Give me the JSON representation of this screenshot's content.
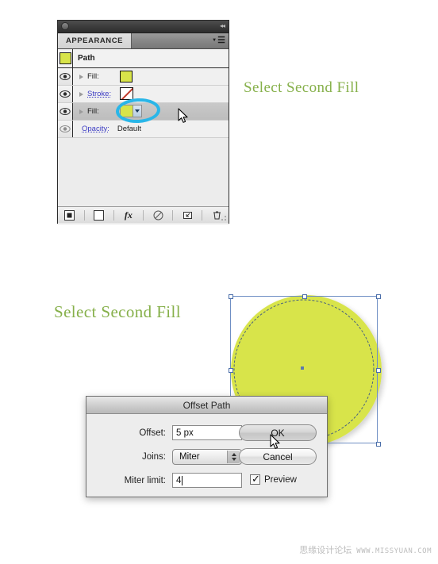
{
  "panel": {
    "tab_label": "APPEARANCE",
    "menu_icon": "panel-menu-icon",
    "collapse_icon": "collapse-arrows-icon",
    "header": {
      "label": "Path",
      "thumbnail_color": "#d8e44a"
    },
    "rows": [
      {
        "label": "Fill:",
        "type": "fill",
        "swatch_color": "#d8e44a",
        "visible": true
      },
      {
        "label": "Stroke:",
        "type": "stroke",
        "swatch_color": "#ffffff",
        "visible": true
      },
      {
        "label": "Fill:",
        "type": "fill-dropdown",
        "swatch_color": "#d8e44a",
        "visible": true,
        "selected": true
      },
      {
        "label": "Opacity:",
        "type": "opacity",
        "value": "Default",
        "visible": true
      }
    ],
    "footer_buttons": [
      {
        "name": "add-new-stroke-button",
        "glyph": "■"
      },
      {
        "name": "add-new-fill-button",
        "glyph": "□"
      },
      {
        "name": "add-new-effect-button",
        "glyph": "fx"
      },
      {
        "name": "clear-appearance-button",
        "glyph": "⊘"
      },
      {
        "name": "duplicate-item-button",
        "glyph": "❐"
      },
      {
        "name": "delete-item-button",
        "glyph": "🗑"
      }
    ]
  },
  "annotations": {
    "top": "Select Second Fill",
    "bottom": "Select Second Fill",
    "color": "#86b04a"
  },
  "artwork": {
    "shape_name": "ellipse",
    "fill_color": "#d8e44a",
    "selection_color": "#6f8fc4"
  },
  "dialog": {
    "title": "Offset Path",
    "fields": {
      "offset_label": "Offset:",
      "offset_value": "5 px",
      "joins_label": "Joins:",
      "joins_value": "Miter",
      "miter_limit_label": "Miter limit:",
      "miter_limit_value": "4"
    },
    "buttons": {
      "ok": "OK",
      "cancel": "Cancel"
    },
    "preview": {
      "label": "Preview",
      "checked": true
    }
  },
  "watermark": {
    "cn": "思缘设计论坛",
    "en": "WWW.MISSYUAN.COM"
  }
}
